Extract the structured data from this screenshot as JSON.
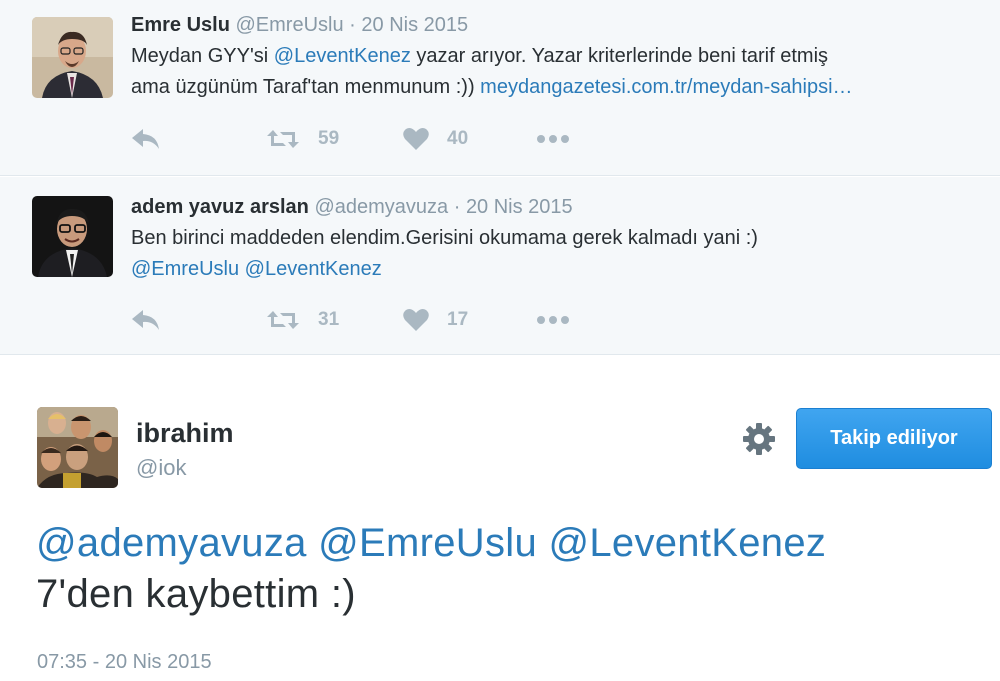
{
  "thread": [
    {
      "name": "Emre Uslu",
      "handle": "@EmreUslu",
      "separator": "·",
      "date": "20 Nis 2015",
      "text_line1_pre": "Meydan GYY'si ",
      "text_line1_mention": "@LeventKenez",
      "text_line1_post": " yazar arıyor. Yazar kriterlerinde beni tarif etmiş",
      "text_line2_pre": "ama üzgünüm Taraf'tan menmunum :)) ",
      "text_line2_link": "meydangazetesi.com.tr/meydan-sahipsi…",
      "retweets": "59",
      "likes": "40",
      "avatar_icon": "man-with-glasses-photo"
    },
    {
      "name": "adem yavuz arslan",
      "handle": "@ademyavuza",
      "separator": "·",
      "date": "20 Nis 2015",
      "text_line1": "Ben birinci maddeden elendim.Gerisini okumama gerek kalmadı yani :)",
      "mention1": "@EmreUslu",
      "mention2": "@LeventKenez",
      "retweets": "31",
      "likes": "17",
      "avatar_icon": "man-with-glasses-dark-photo"
    }
  ],
  "main": {
    "name": "ibrahim",
    "handle": "@iok",
    "follow_label": "Takip ediliyor",
    "mention1": "@ademyavuza",
    "mention2": "@EmreUslu",
    "mention3": "@LeventKenez",
    "text_line2": "7'den kaybettim :)",
    "timestamp": "07:35 - 20 Nis 2015",
    "avatar_icon": "group-selfie-photo",
    "settings_icon": "gear-icon"
  },
  "colors": {
    "link": "#2b7bb9",
    "muted": "#8899a6",
    "action": "#aab8c2",
    "thread_bg": "#f5f8fa",
    "button": "#2b95e9"
  }
}
